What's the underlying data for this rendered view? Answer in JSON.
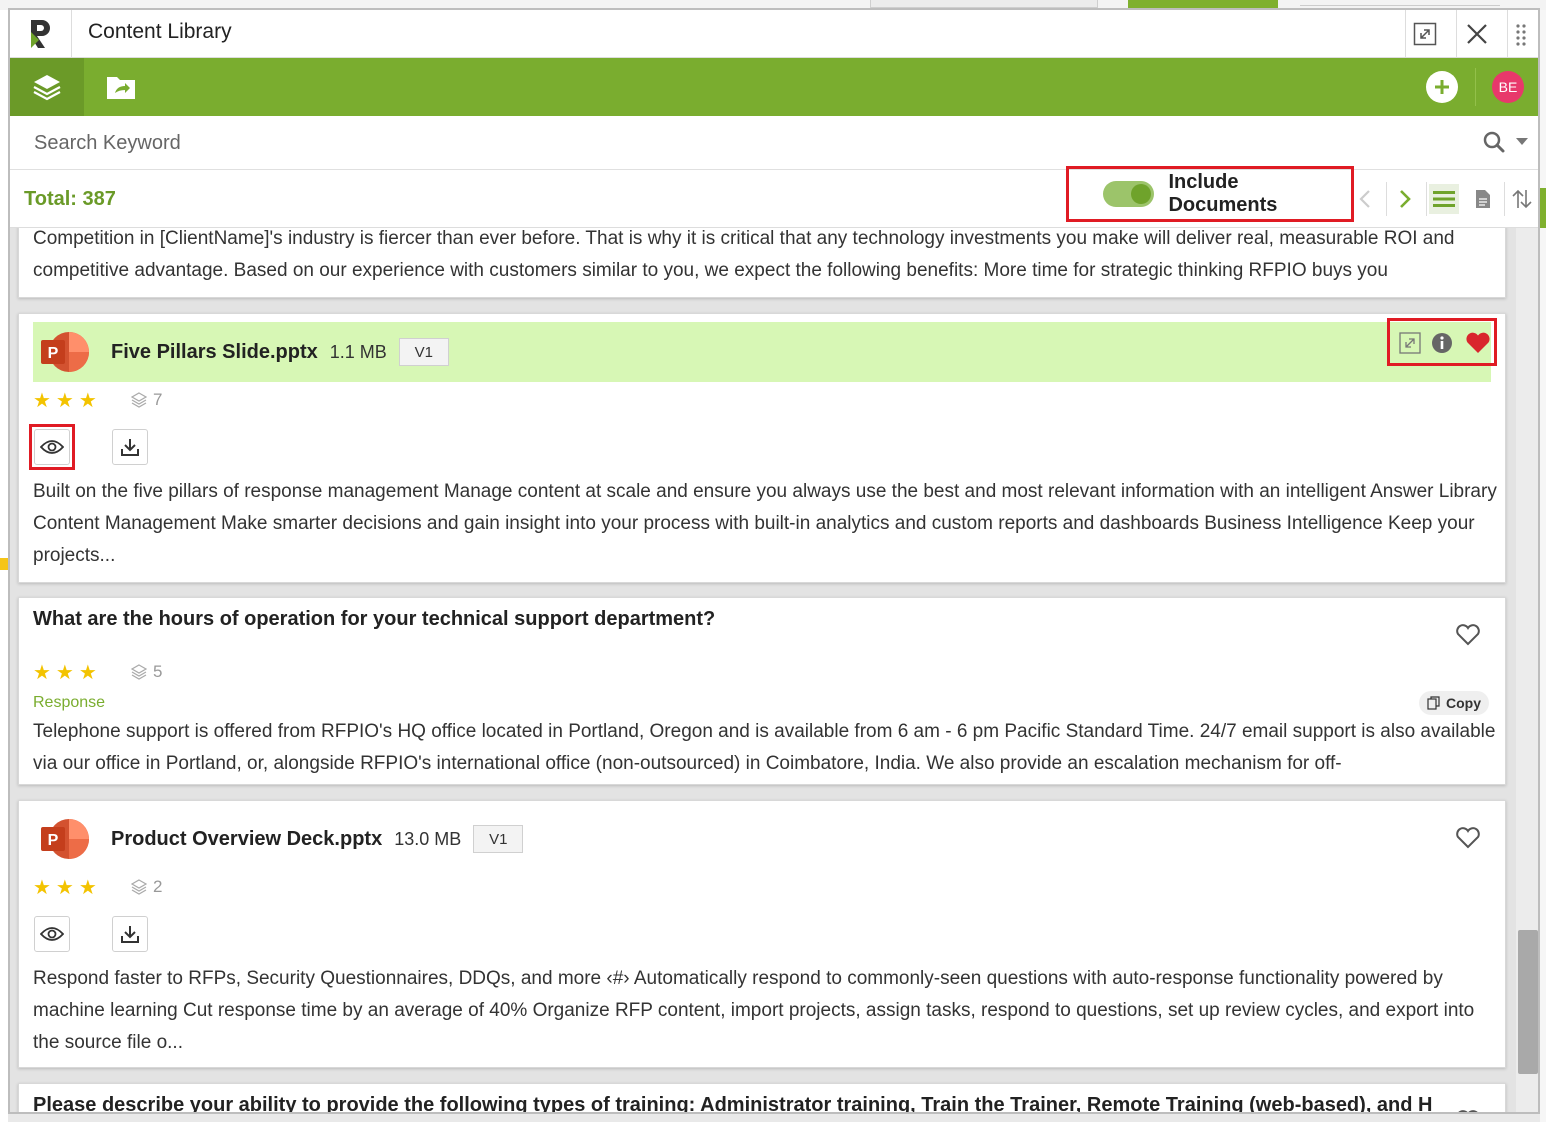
{
  "window": {
    "title": "Content Library"
  },
  "search": {
    "placeholder": "Search Keyword"
  },
  "toolbar": {
    "total_label": "Total: 387",
    "include_documents_label": "Include Documents",
    "include_documents_on": true
  },
  "user": {
    "initials": "BE"
  },
  "colors": {
    "brand_green": "#7aad2f",
    "highlight_green": "#d7f7b5",
    "avatar_pink": "#e8386b",
    "star_yellow": "#f3c300",
    "annotation_red": "#e01b24"
  },
  "list": {
    "partial_card": {
      "text": "Competition in [ClientName]'s industry is fiercer than ever before. That is why it is critical that any technology investments you make will deliver real, measurable ROI and competitive advantage. Based on our experience with customers similar to you, we expect the following benefits: More time for strategic thinking RFPIO buys you"
    },
    "doc1": {
      "name": "Five Pillars Slide.pptx",
      "size": "1.1 MB",
      "version": "V1",
      "stars": "★★★",
      "usage": "7",
      "favorited": true,
      "text": "Built on the five pillars of response management Manage content at scale and ensure you always use the best and most relevant information with an intelligent Answer Library Content Management Make smarter decisions and gain insight into your process with built-in analytics and custom reports and dashboards Business Intelligence Keep your projects..."
    },
    "qa1": {
      "question": "What are the hours of operation for your technical support department?",
      "stars": "★★★",
      "usage": "5",
      "response_label": "Response",
      "copy_label": "Copy",
      "text": "Telephone support is offered from RFPIO's HQ office located in Portland, Oregon and is available from 6 am - 6 pm Pacific Standard Time. 24/7 email support is also available via our office in Portland, or, alongside RFPIO's international office (non-outsourced) in Coimbatore, India. We also provide an escalation mechanism for off-"
    },
    "doc2": {
      "name": "Product Overview Deck.pptx",
      "size": "13.0 MB",
      "version": "V1",
      "stars": "★★★",
      "usage": "2",
      "text": "Respond faster to RFPs, Security Questionnaires, DDQs, and more ‹#› Automatically respond to commonly-seen questions with auto-response functionality powered by machine learning Cut response time by an average of 40% Organize RFP content, import projects, assign tasks, respond to questions, set up review cycles, and export into the source file o..."
    },
    "qa2": {
      "question": "Please describe your ability to provide the following types of training: Administrator training, Train the Trainer, Remote Training (web-based), and Hands"
    }
  }
}
